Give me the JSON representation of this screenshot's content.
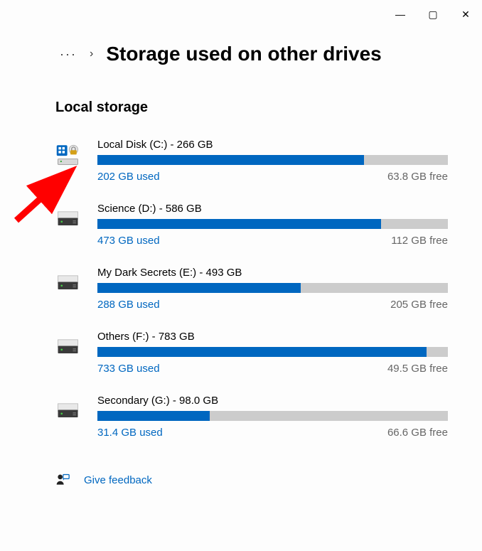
{
  "titlebar": {
    "minimize": "—",
    "maximize": "▢",
    "close": "✕"
  },
  "breadcrumb": {
    "ellipsis": "···",
    "chevron": "›",
    "title": "Storage used on other drives"
  },
  "section_title": "Local storage",
  "drives": [
    {
      "title": "Local Disk (C:) - 266 GB",
      "used": "202 GB used",
      "free": "63.8 GB free",
      "percent": 76,
      "type": "system"
    },
    {
      "title": "Science (D:) - 586 GB",
      "used": "473 GB used",
      "free": "112 GB free",
      "percent": 81,
      "type": "hdd"
    },
    {
      "title": "My Dark Secrets (E:) - 493 GB",
      "used": "288 GB used",
      "free": "205 GB free",
      "percent": 58,
      "type": "hdd"
    },
    {
      "title": "Others (F:) - 783 GB",
      "used": "733 GB used",
      "free": "49.5 GB free",
      "percent": 94,
      "type": "hdd"
    },
    {
      "title": "Secondary (G:) - 98.0 GB",
      "used": "31.4 GB used",
      "free": "66.6 GB free",
      "percent": 32,
      "type": "hdd"
    }
  ],
  "feedback_label": "Give feedback",
  "colors": {
    "accent": "#0067c0",
    "bar_bg": "#cccccc"
  }
}
